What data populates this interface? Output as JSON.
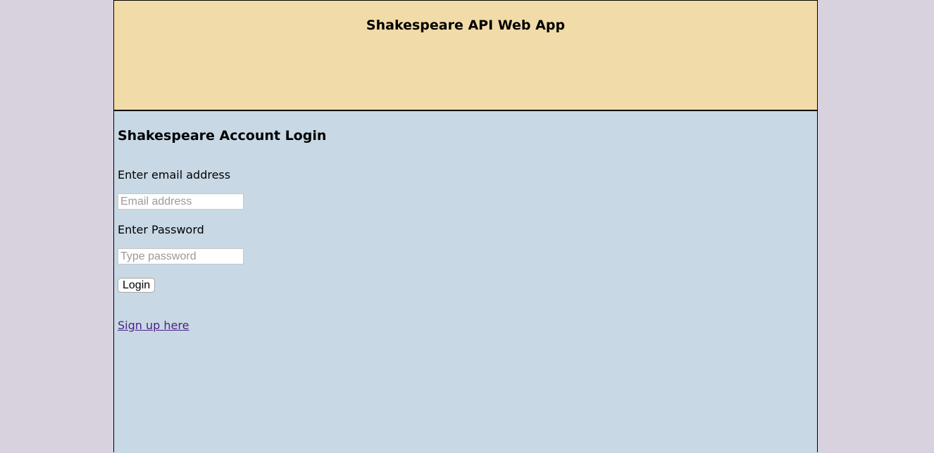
{
  "header": {
    "title": "Shakespeare API Web App"
  },
  "login": {
    "title": "Shakespeare Account Login",
    "email_label": "Enter email address",
    "email_placeholder": "Email address",
    "email_value": "",
    "password_label": "Enter Password",
    "password_placeholder": "Type password",
    "password_value": "",
    "login_button": "Login",
    "signup_link": "Sign up here"
  },
  "colors": {
    "outer_background": "#d8d2df",
    "header_background": "#f1dba8",
    "main_background": "#c8d8e5",
    "link": "#4a1f86"
  }
}
